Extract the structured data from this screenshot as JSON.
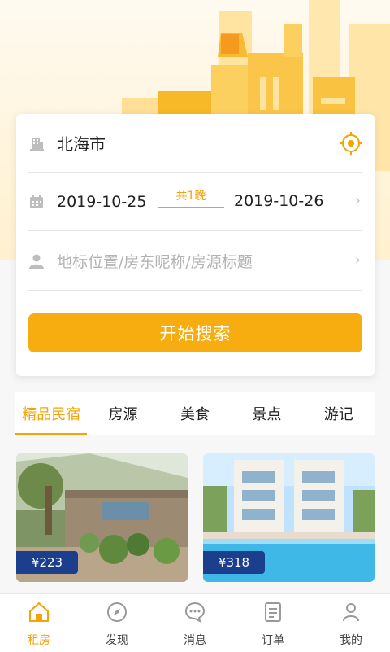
{
  "search": {
    "city": "北海市",
    "checkin": "2019-10-25",
    "checkout": "2019-10-26",
    "nights": "共1晚",
    "keyword_placeholder": "地标位置/房东昵称/房源标题",
    "button_label": "开始搜索"
  },
  "tabs": [
    {
      "label": "精品民宿",
      "active": true
    },
    {
      "label": "房源",
      "active": false
    },
    {
      "label": "美食",
      "active": false
    },
    {
      "label": "景点",
      "active": false
    },
    {
      "label": "游记",
      "active": false
    }
  ],
  "listings": [
    {
      "price": "¥223"
    },
    {
      "price": "¥318"
    }
  ],
  "bottom_nav": [
    {
      "label": "租房",
      "icon": "home-icon",
      "active": true
    },
    {
      "label": "发现",
      "icon": "compass-icon",
      "active": false
    },
    {
      "label": "消息",
      "icon": "message-icon",
      "active": false
    },
    {
      "label": "订单",
      "icon": "order-icon",
      "active": false
    },
    {
      "label": "我的",
      "icon": "profile-icon",
      "active": false
    }
  ],
  "colors": {
    "accent": "#f7ad0f",
    "price_badge": "#1c3f8d"
  }
}
